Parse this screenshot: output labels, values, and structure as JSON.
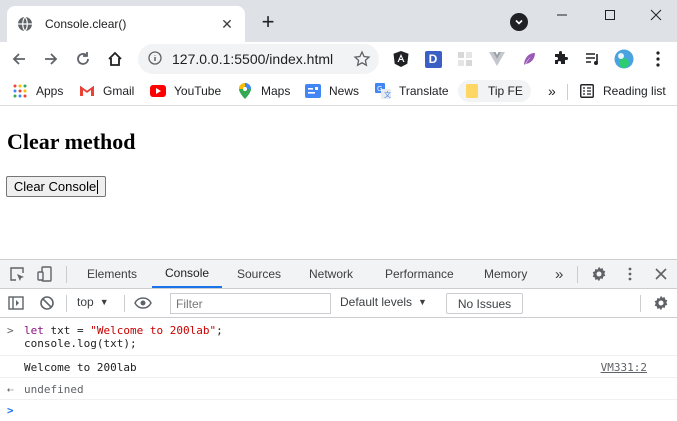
{
  "browser": {
    "tab": {
      "title": "Console.clear()"
    },
    "address": {
      "url": "127.0.0.1:5500/index.html"
    },
    "bookmarks": [
      {
        "label": "Apps"
      },
      {
        "label": "Gmail"
      },
      {
        "label": "YouTube"
      },
      {
        "label": "Maps"
      },
      {
        "label": "News"
      },
      {
        "label": "Translate"
      },
      {
        "label": "Tip FE"
      }
    ],
    "bookmarks_more": "»",
    "reading_list": "Reading list",
    "extensions": [
      {
        "name": "angular-icon",
        "letter": "A"
      },
      {
        "name": "d-extension-icon",
        "letter": "D"
      }
    ]
  },
  "page": {
    "heading": "Clear method",
    "button_label": "Clear Console"
  },
  "devtools": {
    "tabs": [
      {
        "label": "Elements"
      },
      {
        "label": "Console"
      },
      {
        "label": "Sources"
      },
      {
        "label": "Network"
      },
      {
        "label": "Performance"
      },
      {
        "label": "Memory"
      }
    ],
    "more_tabs": "»",
    "context": "top",
    "filter_placeholder": "Filter",
    "levels": "Default levels",
    "issues": "No Issues",
    "console": {
      "input_kw": "let",
      "input_rest_1": " txt = ",
      "input_str": "\"Welcome to 200lab\"",
      "input_rest_2": ";",
      "input_line2": "console.log(txt);",
      "log_output": "Welcome to 200lab",
      "log_source": "VM331:2",
      "result": "undefined"
    }
  },
  "colors": {
    "accent": "#1a73e8",
    "tabstrip": "#dee1e6",
    "keyword": "#881280",
    "string": "#c80000"
  }
}
